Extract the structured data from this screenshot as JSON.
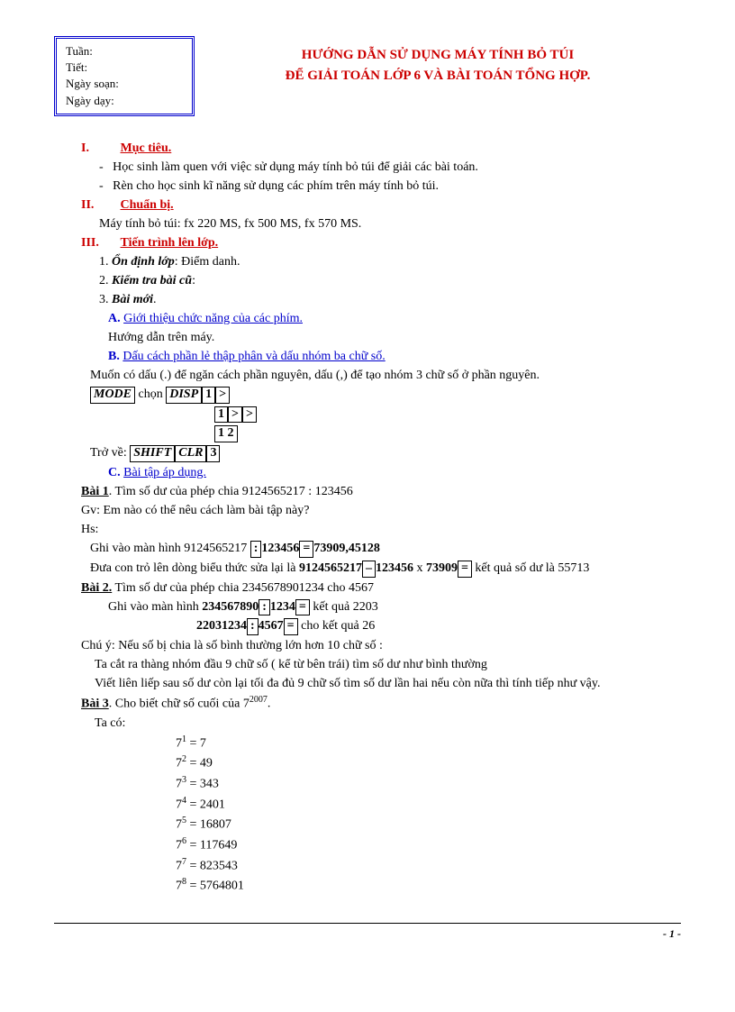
{
  "info": {
    "tuan": "Tuần:",
    "tiet": "Tiết:",
    "soan": "Ngày soạn:",
    "day": "Ngày dạy:"
  },
  "title": {
    "l1": "HƯỚNG DẪN SỬ DỤNG MÁY TÍNH BỎ TÚI",
    "l2": "ĐỂ GIẢI TOÁN LỚP 6 VÀ BÀI TOÁN TỔNG HỢP."
  },
  "s1": {
    "num": "I.",
    "title": "Mục tiêu.",
    "b1": "Học sinh làm quen với việc sử dụng máy tính bỏ túi để giải các bài toán.",
    "b2": "Rèn cho học sinh kĩ năng sử dụng các phím trên máy tính bỏ túi."
  },
  "s2": {
    "num": "II.",
    "title": "Chuẩn bị.",
    "l1": "Máy tính bỏ túi: fx 220 MS, fx 500 MS, fx 570 MS."
  },
  "s3": {
    "num": "III.",
    "title": "Tiến trình lên lớp.",
    "i1n": "1.",
    "i1b": "Ổn định lớp",
    "i1t": ": Điểm danh.",
    "i2n": "2.",
    "i2b": "Kiểm tra bài cũ",
    "i2t": ":",
    "i3n": "3.",
    "i3b": "Bài mới",
    "i3t": "."
  },
  "subA": {
    "letter": "A.",
    "title": "Giới thiệu chức năng của các phím.",
    "l1": "Hướng dẫn trên máy."
  },
  "subB": {
    "letter": "B.",
    "title": "Dấu cách phần lẻ thập phân và dấu nhóm ba chữ số.",
    "l1": "Muốn có dấu (.) để ngăn cách phần nguyên, dấu (,) để tạo nhóm 3 chữ số ở phần nguyên.",
    "mode": "MODE",
    "chon": " chọn ",
    "disp": "DISP",
    "k1": "1",
    "gt": ">",
    "k12": "1 2",
    "trove": "Trở về: ",
    "shift": "SHIFT",
    "clr": "CLR",
    "k3": "3"
  },
  "subC": {
    "letter": "C.",
    "title": "Bài tập áp dụng."
  },
  "bai1": {
    "label": "Bài 1",
    "q": ". Tìm số dư của phép chia 9124565217 : 123456",
    "gv": "Gv: Em nào có thể nêu cách làm bài tập này?",
    "hs": "Hs:",
    "ghi": "Ghi vào màn hình 9124565217 ",
    "div": ":",
    "n1": "123456",
    "eq": "=",
    "r1": "73909,45128",
    "dua1": "Đưa con trỏ lên dòng biểu thức sửa lại là ",
    "expr1": "9124565217",
    "minus": "–",
    "expr2": "123456",
    "x": " x ",
    "expr3": "73909",
    "dua2": " kết quả số dư là 55713"
  },
  "bai2": {
    "label": "Bài 2.",
    "q": " Tìm số dư của phép chia 2345678901234 cho 4567",
    "ghi": "Ghi vào màn hình ",
    "n1": "234567890",
    "div": ":",
    "n2": "1234",
    "eq": "=",
    "kq1": " kết quả 2203",
    "n3": "22031234",
    "n4": "4567",
    "kq2": " cho kết quả 26",
    "chu": "Chú ý: Nếu số bị chia là số bình thường lớn hơn 10 chữ số :",
    "ta": "Ta cắt ra thàng nhóm đầu 9 chữ số ( kể từ bên trái) tìm số dư như bình thường",
    "viet": "Viết liên liếp sau số dư còn lại tối đa đủ 9 chữ số tìm số dư lần hai nếu còn nữa thì tính tiếp như vậy."
  },
  "bai3": {
    "label": "Bài 3",
    "q": ". Cho biết chữ số cuối của 7",
    "exp": "2007",
    "dot": ".",
    "taco": "Ta có:",
    "p": [
      {
        "b": "7",
        "e": "1",
        "v": " = 7"
      },
      {
        "b": "7",
        "e": "2",
        "v": " = 49"
      },
      {
        "b": "7",
        "e": "3",
        "v": " = 343"
      },
      {
        "b": "7",
        "e": "4",
        "v": " = 2401"
      },
      {
        "b": "7",
        "e": "5",
        "v": " = 16807"
      },
      {
        "b": "7",
        "e": "6",
        "v": " = 117649"
      },
      {
        "b": "7",
        "e": "7",
        "v": " = 823543"
      },
      {
        "b": "7",
        "e": "8",
        "v": " = 5764801"
      }
    ]
  },
  "footer": "- 1 -"
}
